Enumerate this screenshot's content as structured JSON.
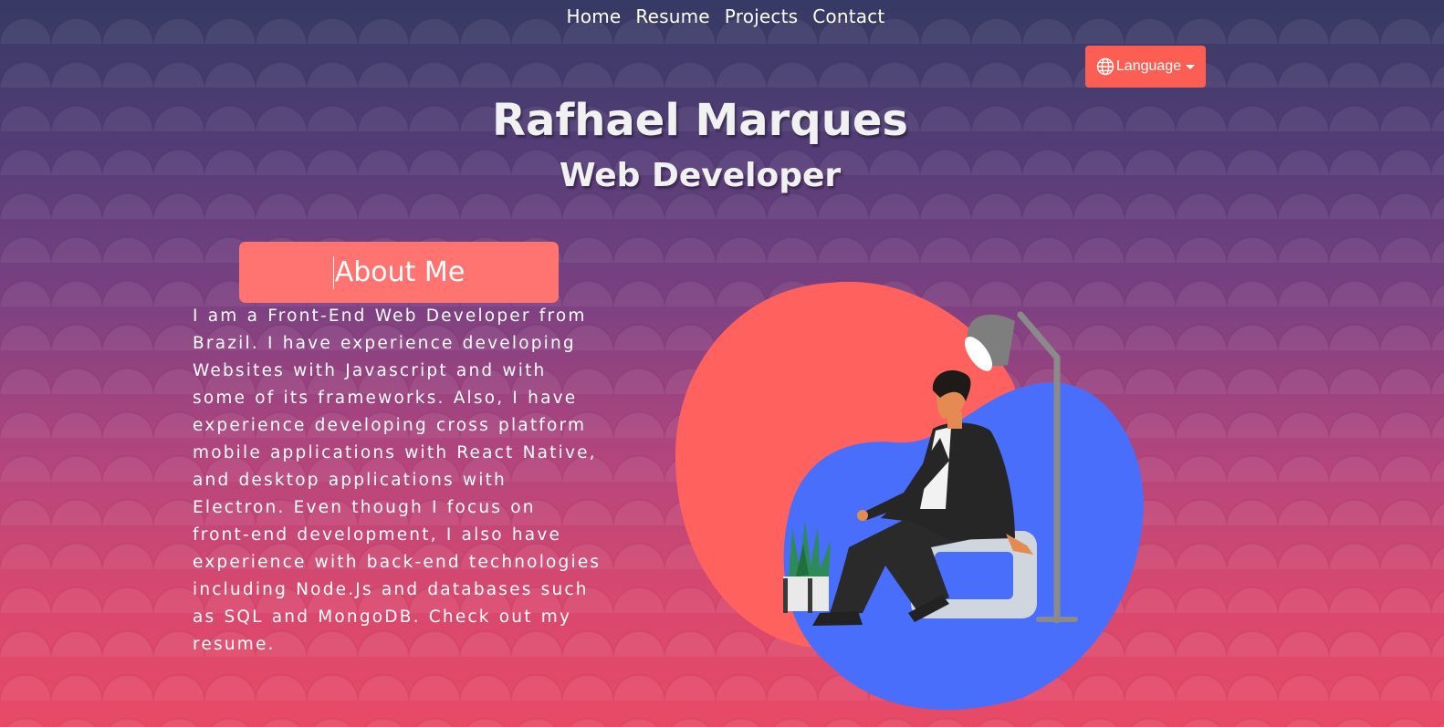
{
  "nav": {
    "items": [
      {
        "label": "Home"
      },
      {
        "label": "Resume"
      },
      {
        "label": "Projects"
      },
      {
        "label": "Contact"
      }
    ]
  },
  "language": {
    "label": "Language",
    "icon": "globe-icon"
  },
  "hero": {
    "name": "Rafhael Marques",
    "role": "Web Developer"
  },
  "about": {
    "title": "About Me",
    "body": "I am a Front-End Web Developer from Brazil. I have experience developing Websites with Javascript and with some of its frameworks. Also, I have experience developing cross platform mobile applications with React Native, and desktop applications with Electron. Even though I focus on front-end development, I also have experience with back-end technologies including Node.Js and databases such as SQL and MongoDB. Check out my resume."
  },
  "colors": {
    "accent": "#fd5e53",
    "about_header": "#ff7370",
    "blob_coral": "#ff625e",
    "blob_blue": "#4a6efc"
  }
}
